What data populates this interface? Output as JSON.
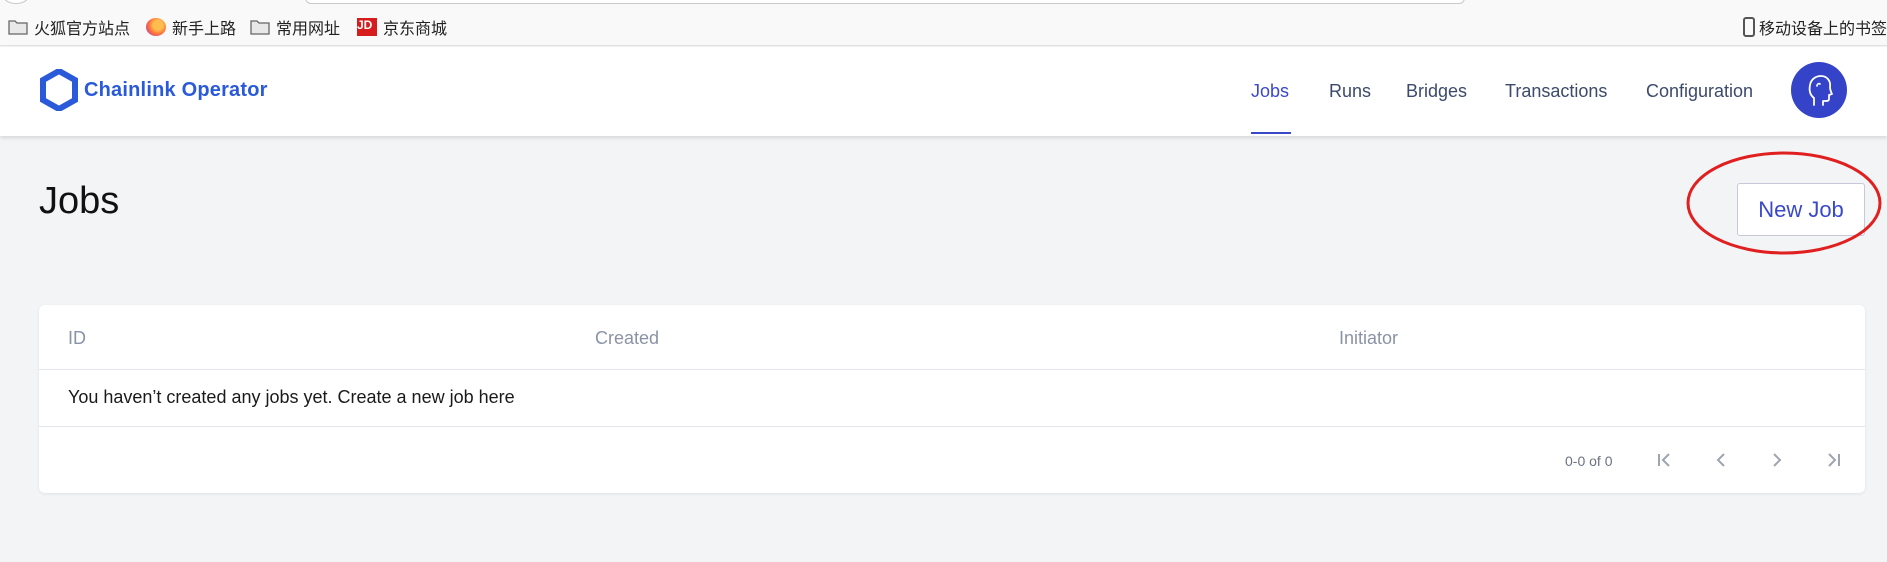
{
  "bookmarks": {
    "items": [
      {
        "label": "火狐官方站点",
        "icon": "folder-icon"
      },
      {
        "label": "新手上路",
        "icon": "firefox-icon"
      },
      {
        "label": "常用网址",
        "icon": "folder-icon"
      },
      {
        "label": "京东商城",
        "icon": "jd-icon",
        "icon_text": "JD"
      }
    ],
    "mobile_label": "移动设备上的书签"
  },
  "header": {
    "brand": "Chainlink Operator",
    "nav": [
      {
        "label": "Jobs",
        "active": true
      },
      {
        "label": "Runs",
        "active": false
      },
      {
        "label": "Bridges",
        "active": false
      },
      {
        "label": "Transactions",
        "active": false
      },
      {
        "label": "Configuration",
        "active": false
      }
    ],
    "avatar_icon": "user-head-icon"
  },
  "page": {
    "title": "Jobs",
    "new_job_label": "New Job"
  },
  "table": {
    "columns": [
      "ID",
      "Created",
      "Initiator"
    ],
    "empty_message": "You haven’t created any jobs yet. Create a new job here",
    "pagination": {
      "range_text": "0-0 of 0"
    }
  },
  "colors": {
    "brand": "#2a5ada",
    "accent": "#3949c9",
    "annotation": "#e02020"
  }
}
